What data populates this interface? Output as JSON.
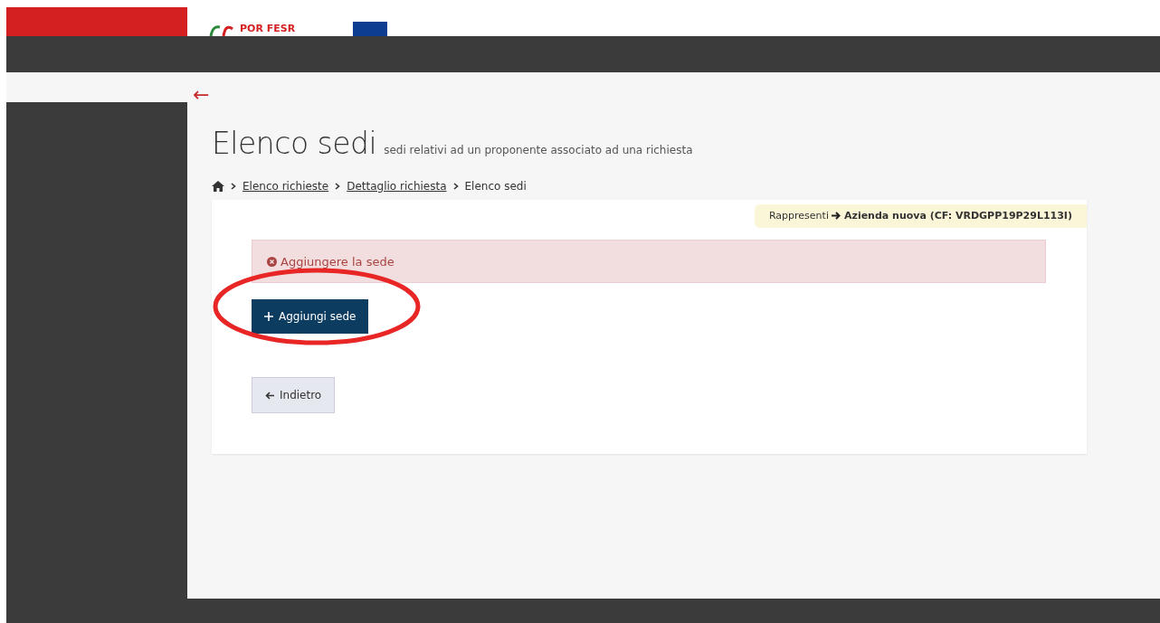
{
  "header": {
    "logo_text": "POR FESR"
  },
  "back_link": {
    "label": "←"
  },
  "page": {
    "title": "Elenco sedi",
    "subtitle": "sedi relativi ad un proponente associato ad una richiesta"
  },
  "breadcrumb": [
    {
      "label": "Elenco richieste",
      "kind": "link"
    },
    {
      "label": "Dettaglio richiesta",
      "kind": "link"
    },
    {
      "label": "Elenco sedi",
      "kind": "current"
    }
  ],
  "represent_badge": {
    "prefix": "Rappresenti",
    "entity": "Azienda nuova (CF: VRDGPP19P29L113I)"
  },
  "alert": {
    "text": "Aggiungere la sede"
  },
  "buttons": [
    {
      "label": "Aggiungi sede",
      "kind": "primary"
    },
    {
      "label": "Indietro",
      "kind": "back"
    }
  ]
}
